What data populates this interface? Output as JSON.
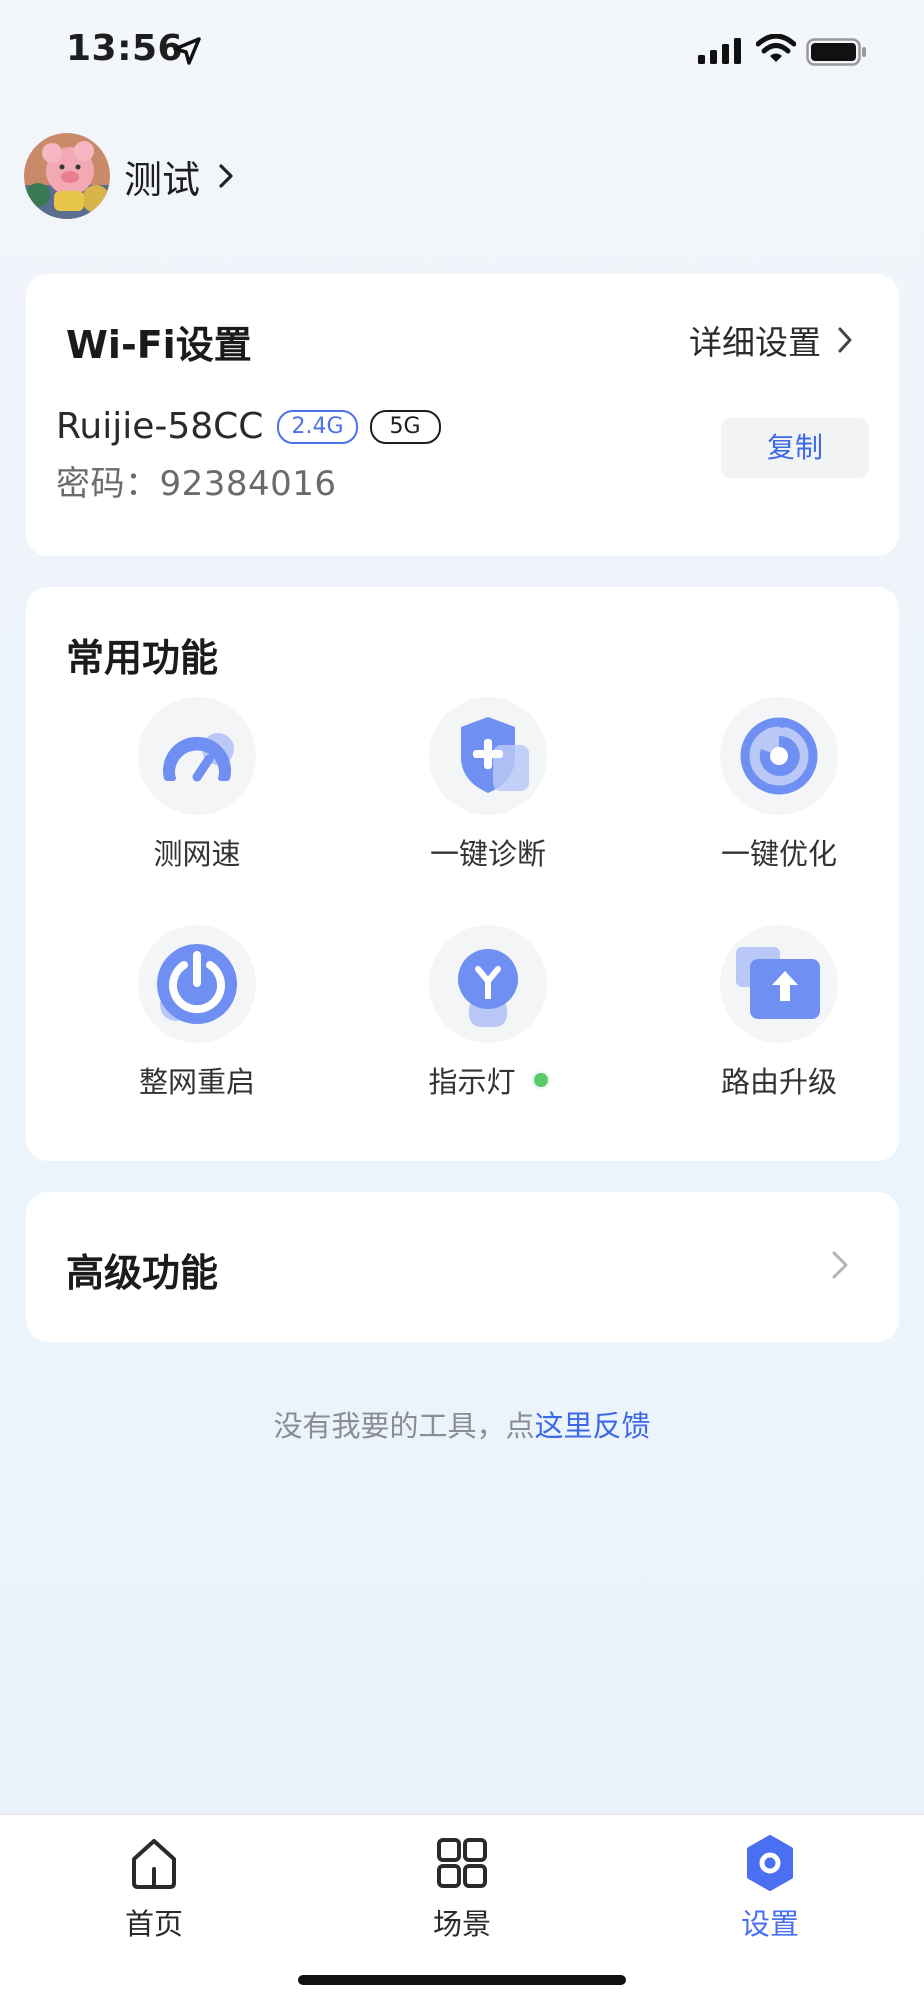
{
  "status_bar": {
    "time": "13:56"
  },
  "profile": {
    "name": "测试"
  },
  "wifi_card": {
    "title": "Wi-Fi设置",
    "detail_label": "详细设置",
    "ssid": "Ruijie-58CC",
    "band_24": "2.4G",
    "band_5": "5G",
    "password_label": "密码：",
    "password": "92384016",
    "copy_label": "复制"
  },
  "common_card": {
    "title": "常用功能",
    "items": [
      {
        "label": "测网速",
        "icon": "speedometer-icon"
      },
      {
        "label": "一键诊断",
        "icon": "shield-plus-icon"
      },
      {
        "label": "一键优化",
        "icon": "timer-icon"
      },
      {
        "label": "整网重启",
        "icon": "power-icon"
      },
      {
        "label": "指示灯",
        "icon": "bulb-icon",
        "status": "on"
      },
      {
        "label": "路由升级",
        "icon": "upgrade-icon"
      }
    ]
  },
  "advanced_card": {
    "title": "高级功能"
  },
  "feedback": {
    "prefix": "没有我要的工具，点",
    "link": "这里反馈"
  },
  "tab_bar": {
    "tabs": [
      {
        "label": "首页",
        "icon": "home-icon"
      },
      {
        "label": "场景",
        "icon": "grid-icon"
      },
      {
        "label": "设置",
        "icon": "settings-gear-icon",
        "active": true
      }
    ]
  },
  "colors": {
    "accent": "#4a6ff0",
    "icon_blue": "#6f8ff2",
    "status_on": "#5cc86a"
  }
}
